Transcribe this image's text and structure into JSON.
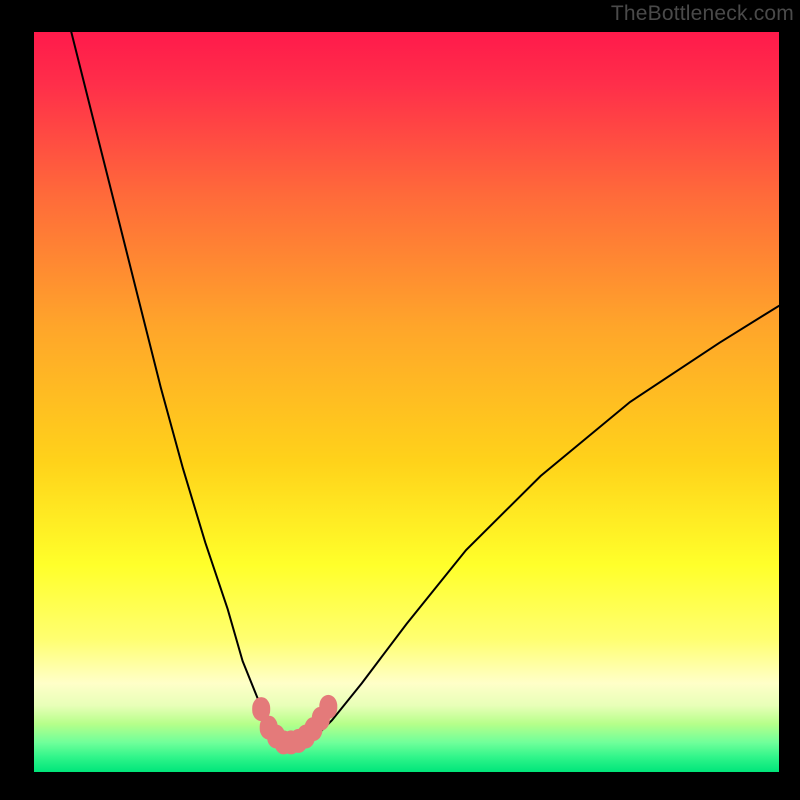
{
  "watermark": "TheBottleneck.com",
  "palette": {
    "black": "#000000",
    "curve": "#000000",
    "marker_fill": "#e47a7a",
    "marker_stroke": "#d15c5c",
    "gradient_top": "#ff1a4b",
    "gradient_mid1": "#ff7a2e",
    "gradient_mid2": "#ffd21a",
    "gradient_yellow": "#ffff33",
    "gradient_pale": "#ffffb0",
    "gradient_green1": "#b6ff8a",
    "gradient_green2": "#52ff9c",
    "gradient_green3": "#00e57a"
  },
  "chart_data": {
    "type": "line",
    "title": "",
    "xlabel": "",
    "ylabel": "",
    "xlim": [
      0,
      100
    ],
    "ylim": [
      0,
      100
    ],
    "series": [
      {
        "name": "bottleneck-curve",
        "x": [
          5,
          8,
          11,
          14,
          17,
          20,
          23,
          26,
          28,
          30,
          31.5,
          33,
          34.5,
          36,
          38,
          40,
          44,
          50,
          58,
          68,
          80,
          92,
          100
        ],
        "y": [
          100,
          88,
          76,
          64,
          52,
          41,
          31,
          22,
          15,
          10,
          7,
          5,
          4,
          4,
          5,
          7,
          12,
          20,
          30,
          40,
          50,
          58,
          63
        ]
      }
    ],
    "markers": {
      "name": "highlight-dots",
      "x": [
        30.5,
        31.5,
        32.5,
        33.5,
        34.5,
        35.5,
        36.5,
        37.5,
        38.5,
        39.5
      ],
      "y": [
        8.5,
        6.0,
        4.8,
        4.0,
        4.0,
        4.2,
        4.8,
        5.8,
        7.2,
        8.8
      ]
    }
  }
}
